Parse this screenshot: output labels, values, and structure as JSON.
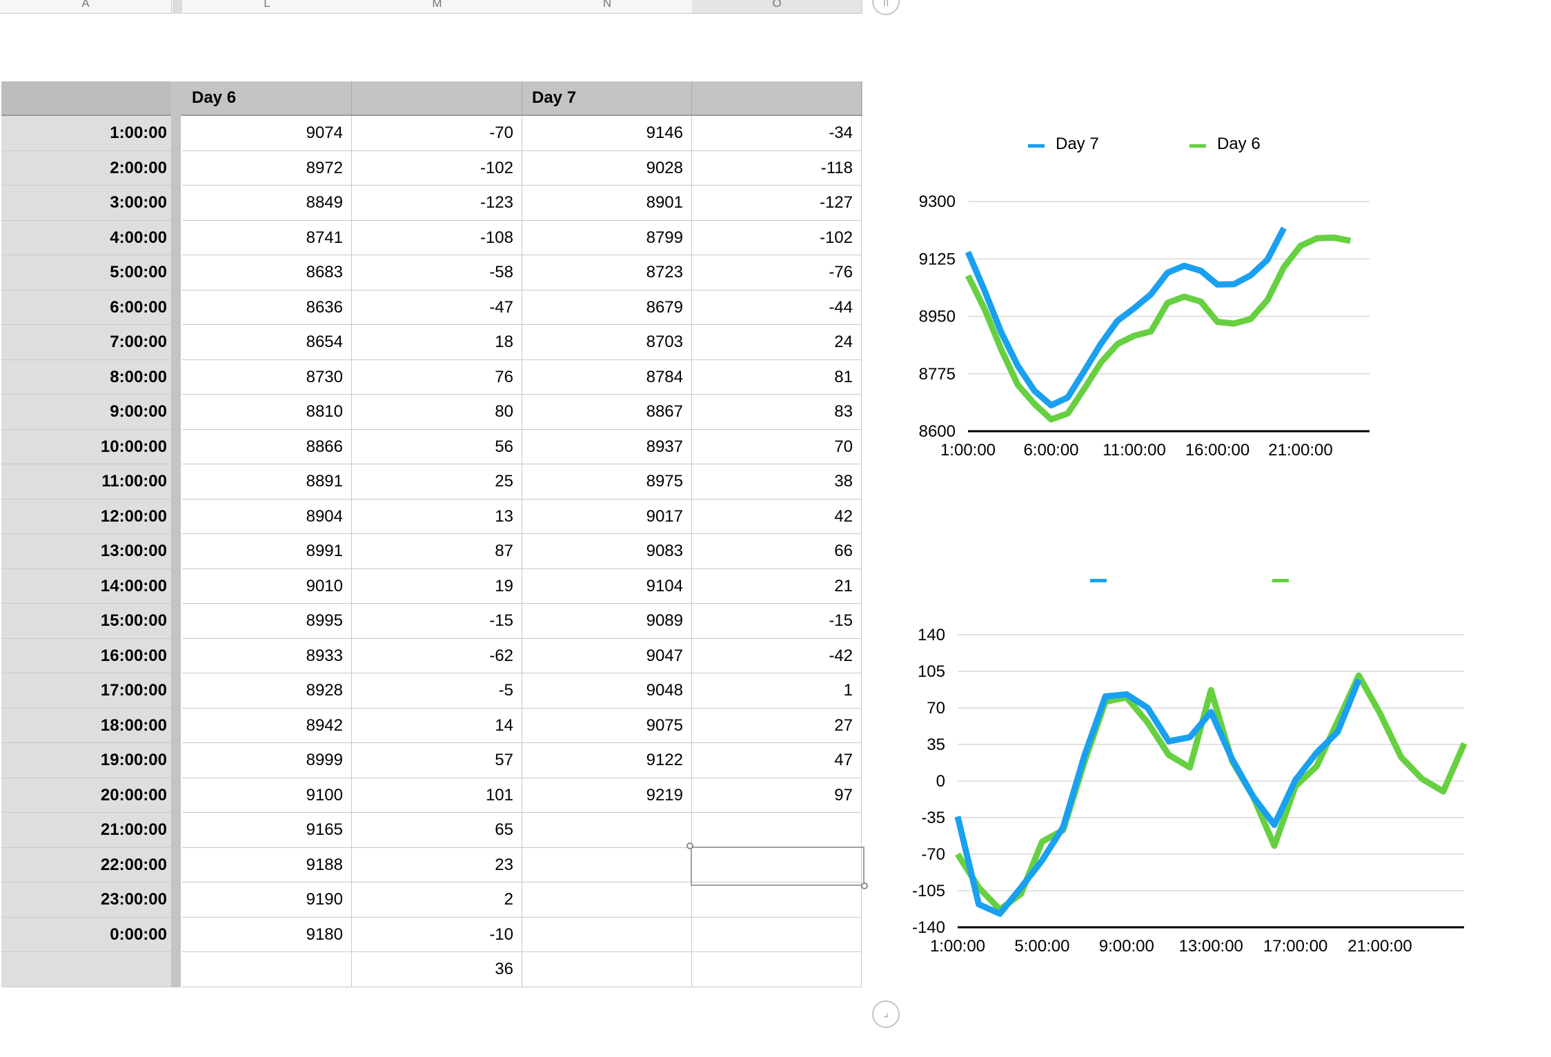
{
  "column_headers": [
    "A",
    "L",
    "M",
    "N",
    "O"
  ],
  "table": {
    "headers": [
      "Day 6",
      "Day 7"
    ],
    "rows": [
      {
        "time": "1:00:00",
        "d6": "9074",
        "d6c": "-70",
        "d7": "9146",
        "d7c": "-34"
      },
      {
        "time": "2:00:00",
        "d6": "8972",
        "d6c": "-102",
        "d7": "9028",
        "d7c": "-118"
      },
      {
        "time": "3:00:00",
        "d6": "8849",
        "d6c": "-123",
        "d7": "8901",
        "d7c": "-127"
      },
      {
        "time": "4:00:00",
        "d6": "8741",
        "d6c": "-108",
        "d7": "8799",
        "d7c": "-102"
      },
      {
        "time": "5:00:00",
        "d6": "8683",
        "d6c": "-58",
        "d7": "8723",
        "d7c": "-76"
      },
      {
        "time": "6:00:00",
        "d6": "8636",
        "d6c": "-47",
        "d7": "8679",
        "d7c": "-44"
      },
      {
        "time": "7:00:00",
        "d6": "8654",
        "d6c": "18",
        "d7": "8703",
        "d7c": "24"
      },
      {
        "time": "8:00:00",
        "d6": "8730",
        "d6c": "76",
        "d7": "8784",
        "d7c": "81"
      },
      {
        "time": "9:00:00",
        "d6": "8810",
        "d6c": "80",
        "d7": "8867",
        "d7c": "83"
      },
      {
        "time": "10:00:00",
        "d6": "8866",
        "d6c": "56",
        "d7": "8937",
        "d7c": "70"
      },
      {
        "time": "11:00:00",
        "d6": "8891",
        "d6c": "25",
        "d7": "8975",
        "d7c": "38"
      },
      {
        "time": "12:00:00",
        "d6": "8904",
        "d6c": "13",
        "d7": "9017",
        "d7c": "42"
      },
      {
        "time": "13:00:00",
        "d6": "8991",
        "d6c": "87",
        "d7": "9083",
        "d7c": "66"
      },
      {
        "time": "14:00:00",
        "d6": "9010",
        "d6c": "19",
        "d7": "9104",
        "d7c": "21"
      },
      {
        "time": "15:00:00",
        "d6": "8995",
        "d6c": "-15",
        "d7": "9089",
        "d7c": "-15"
      },
      {
        "time": "16:00:00",
        "d6": "8933",
        "d6c": "-62",
        "d7": "9047",
        "d7c": "-42"
      },
      {
        "time": "17:00:00",
        "d6": "8928",
        "d6c": "-5",
        "d7": "9048",
        "d7c": "1"
      },
      {
        "time": "18:00:00",
        "d6": "8942",
        "d6c": "14",
        "d7": "9075",
        "d7c": "27"
      },
      {
        "time": "19:00:00",
        "d6": "8999",
        "d6c": "57",
        "d7": "9122",
        "d7c": "47"
      },
      {
        "time": "20:00:00",
        "d6": "9100",
        "d6c": "101",
        "d7": "9219",
        "d7c": "97"
      },
      {
        "time": "21:00:00",
        "d6": "9165",
        "d6c": "65",
        "d7": "",
        "d7c": ""
      },
      {
        "time": "22:00:00",
        "d6": "9188",
        "d6c": "23",
        "d7": "",
        "d7c": ""
      },
      {
        "time": "23:00:00",
        "d6": "9190",
        "d6c": "2",
        "d7": "",
        "d7c": ""
      },
      {
        "time": "0:00:00",
        "d6": "9180",
        "d6c": "-10",
        "d7": "",
        "d7c": ""
      },
      {
        "time": "",
        "d6": "",
        "d6c": "36",
        "d7": "",
        "d7c": ""
      }
    ]
  },
  "colors": {
    "day7": "#1aa0f0",
    "day6": "#66d040",
    "grid": "#d9d9d9",
    "axis": "#000000"
  },
  "chart_data": [
    {
      "type": "line",
      "title": "",
      "legend": "top",
      "x": [
        "1:00:00",
        "2:00:00",
        "3:00:00",
        "4:00:00",
        "5:00:00",
        "6:00:00",
        "7:00:00",
        "8:00:00",
        "9:00:00",
        "10:00:00",
        "11:00:00",
        "12:00:00",
        "13:00:00",
        "14:00:00",
        "15:00:00",
        "16:00:00",
        "17:00:00",
        "18:00:00",
        "19:00:00",
        "20:00:00",
        "21:00:00",
        "22:00:00",
        "23:00:00",
        "0:00:00"
      ],
      "x_tick_labels": [
        "1:00:00",
        "6:00:00",
        "11:00:00",
        "16:00:00",
        "21:00:00"
      ],
      "ylim": [
        8600,
        9300
      ],
      "y_ticks": [
        "9300",
        "9125",
        "8950",
        "8775",
        "8600"
      ],
      "grid": true,
      "series": [
        {
          "name": "Day 7",
          "color": "#1aa0f0",
          "values": [
            9146,
            9028,
            8901,
            8799,
            8723,
            8679,
            8703,
            8784,
            8867,
            8937,
            8975,
            9017,
            9083,
            9104,
            9089,
            9047,
            9048,
            9075,
            9122,
            9219
          ]
        },
        {
          "name": "Day 6",
          "color": "#66d040",
          "values": [
            9074,
            8972,
            8849,
            8741,
            8683,
            8636,
            8654,
            8730,
            8810,
            8866,
            8891,
            8904,
            8991,
            9010,
            8995,
            8933,
            8928,
            8942,
            8999,
            9100,
            9165,
            9188,
            9190,
            9180
          ]
        }
      ]
    },
    {
      "type": "line",
      "title": "",
      "legend": "top",
      "x": [
        "1:00:00",
        "2:00:00",
        "3:00:00",
        "4:00:00",
        "5:00:00",
        "6:00:00",
        "7:00:00",
        "8:00:00",
        "9:00:00",
        "10:00:00",
        "11:00:00",
        "12:00:00",
        "13:00:00",
        "14:00:00",
        "15:00:00",
        "16:00:00",
        "17:00:00",
        "18:00:00",
        "19:00:00",
        "20:00:00",
        "21:00:00",
        "22:00:00",
        "23:00:00",
        "0:00:00",
        "1:00:00"
      ],
      "x_tick_labels": [
        "1:00:00",
        "5:00:00",
        "9:00:00",
        "13:00:00",
        "17:00:00",
        "21:00:00"
      ],
      "ylim": [
        -140,
        140
      ],
      "y_ticks": [
        "140",
        "105",
        "70",
        "35",
        "0",
        "-35",
        "-70",
        "-105",
        "-140"
      ],
      "grid": true,
      "series": [
        {
          "color": "#1aa0f0",
          "values": [
            -34,
            -118,
            -127,
            -102,
            -76,
            -44,
            24,
            81,
            83,
            70,
            38,
            42,
            66,
            21,
            -15,
            -42,
            1,
            27,
            47,
            97
          ]
        },
        {
          "color": "#66d040",
          "values": [
            -70,
            -102,
            -123,
            -108,
            -58,
            -47,
            18,
            76,
            80,
            56,
            25,
            13,
            87,
            19,
            -15,
            -62,
            -5,
            14,
            57,
            101,
            65,
            23,
            2,
            -10,
            36
          ]
        }
      ]
    }
  ]
}
